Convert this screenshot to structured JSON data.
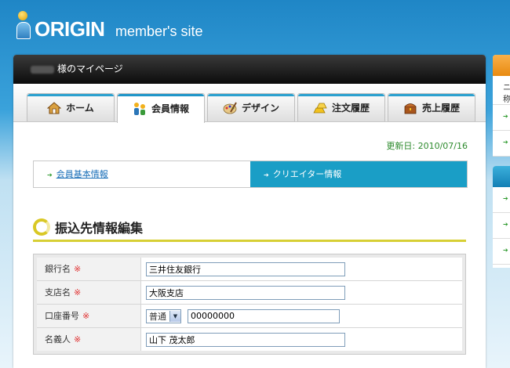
{
  "header": {
    "brand_main": "ORIGIN",
    "brand_sub": "member's site"
  },
  "userbar": {
    "greeting": "様のマイページ"
  },
  "tabs": [
    {
      "label": "ホーム",
      "icon": "house-icon"
    },
    {
      "label": "会員情報",
      "icon": "members-icon",
      "active": true
    },
    {
      "label": "デザイン",
      "icon": "palette-icon"
    },
    {
      "label": "注文履歴",
      "icon": "gold-bars-icon"
    },
    {
      "label": "売上履歴",
      "icon": "treasure-chest-icon"
    }
  ],
  "updated": "更新日: 2010/07/16",
  "subtabs": {
    "basic": "会員基本情報",
    "creator": "クリエイター情報"
  },
  "section_title": "振込先情報編集",
  "form": {
    "required_mark": "※",
    "bank_label": "銀行名",
    "bank_value": "三井住友銀行",
    "branch_label": "支店名",
    "branch_value": "大阪支店",
    "account_label": "口座番号",
    "account_type": "普通",
    "account_value": "00000000",
    "holder_label": "名義人",
    "holder_value": "山下 茂太郎"
  },
  "side": {
    "snippet": "ニ 称"
  },
  "colors": {
    "accent_blue": "#1a9ec6",
    "required": "#e03030",
    "updated_green": "#2e8b2e",
    "section_line": "#d7cf35"
  }
}
